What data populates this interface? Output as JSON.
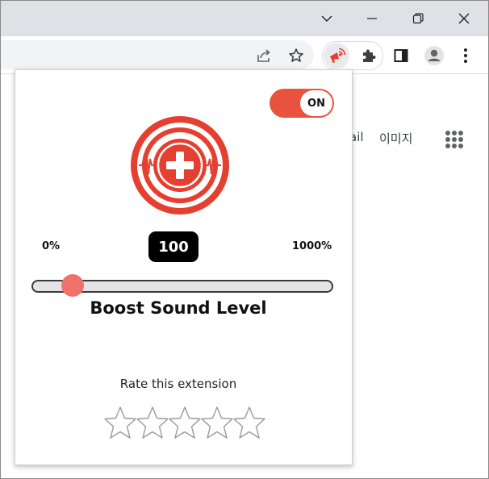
{
  "window": {
    "controls": [
      {
        "name": "tab-search",
        "icon": "chevron-down-icon"
      },
      {
        "name": "minimize",
        "icon": "minimize-icon"
      },
      {
        "name": "restore",
        "icon": "restore-icon"
      },
      {
        "name": "close",
        "icon": "close-icon"
      }
    ]
  },
  "toolbar": {
    "icons": [
      "share-icon",
      "star-icon",
      "extension-icon",
      "puzzle-icon",
      "side-panel-icon",
      "profile-icon",
      "menu-icon"
    ]
  },
  "page": {
    "gmail_partial": "ail",
    "images_link": "이미지"
  },
  "popup": {
    "toggle_label": "ON",
    "min_label": "0%",
    "max_label": "1000%",
    "value": "100",
    "slider": {
      "min": 0,
      "max": 1000,
      "value": 100
    },
    "title": "Boost Sound Level",
    "rate_label": "Rate this extension",
    "stars": {
      "count": 5,
      "filled": 0
    },
    "accent_color": "#e53f2f",
    "thumb_color": "#f0716a"
  }
}
